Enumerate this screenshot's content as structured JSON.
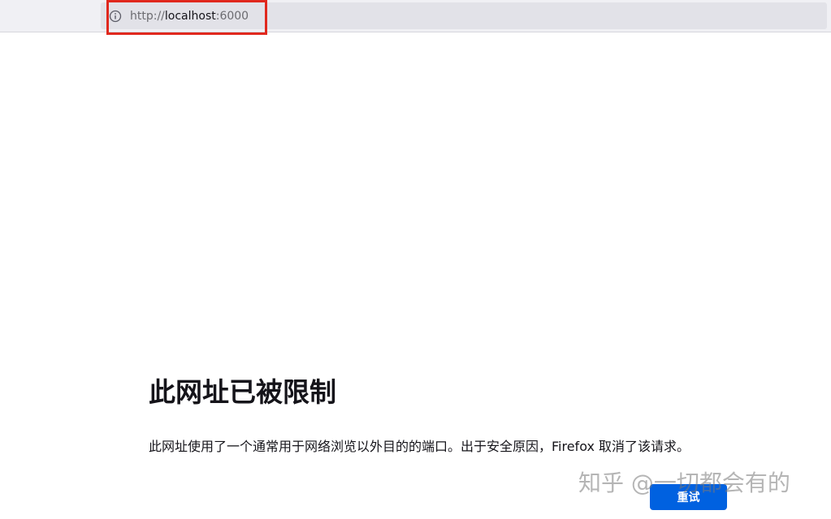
{
  "browser": {
    "url_prefix": "http://",
    "url_host": "localhost",
    "url_suffix": ":6000",
    "info_icon": "info-icon",
    "highlight_color": "#e0281e"
  },
  "error_page": {
    "title": "此网址已被限制",
    "description": "此网址使用了一个通常用于网络浏览以外目的的端口。出于安全原因，Firefox 取消了该请求。",
    "retry_label": "重试",
    "retry_color": "#0061e0"
  },
  "watermark": {
    "text": "知乎 @一切都会有的"
  }
}
